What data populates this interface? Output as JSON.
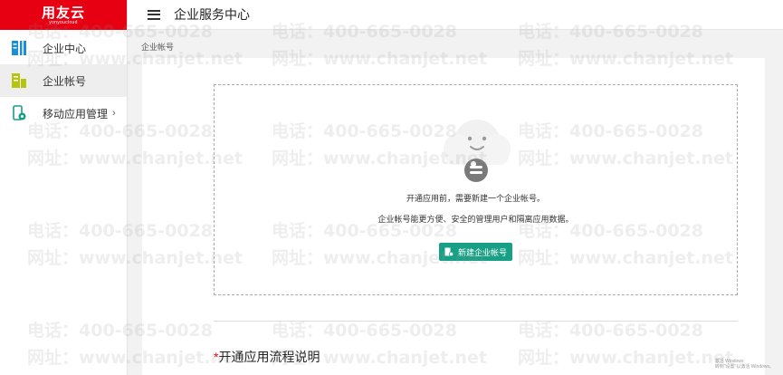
{
  "logo": {
    "main": "用友云",
    "sub": "yonyoucloud"
  },
  "sidebar": {
    "items": [
      {
        "label": "企业中心"
      },
      {
        "label": "企业帐号"
      },
      {
        "label": "移动应用管理",
        "chevron": "›"
      }
    ]
  },
  "topbar": {
    "title": "企业服务中心"
  },
  "breadcrumb": "企业帐号",
  "empty_state": {
    "line1": "开通应用前，需要新建一个企业帐号。",
    "line2": "企业帐号能更方便、安全的管理用户和隔离应用数据。",
    "button_label": "新建企业帐号"
  },
  "section": {
    "star": "*",
    "title": "开通应用流程说明"
  },
  "watermark": {
    "phone": "电话：400-665-0028",
    "site": "网址：www.chanjet.net"
  },
  "activation": {
    "line1": "激活 Windows",
    "line2": "转到\"设置\"以激活 Windows。"
  },
  "colors": {
    "brand_red": "#e60012",
    "accent_green": "#17a085",
    "icon_blue": "#1a8fd8"
  }
}
